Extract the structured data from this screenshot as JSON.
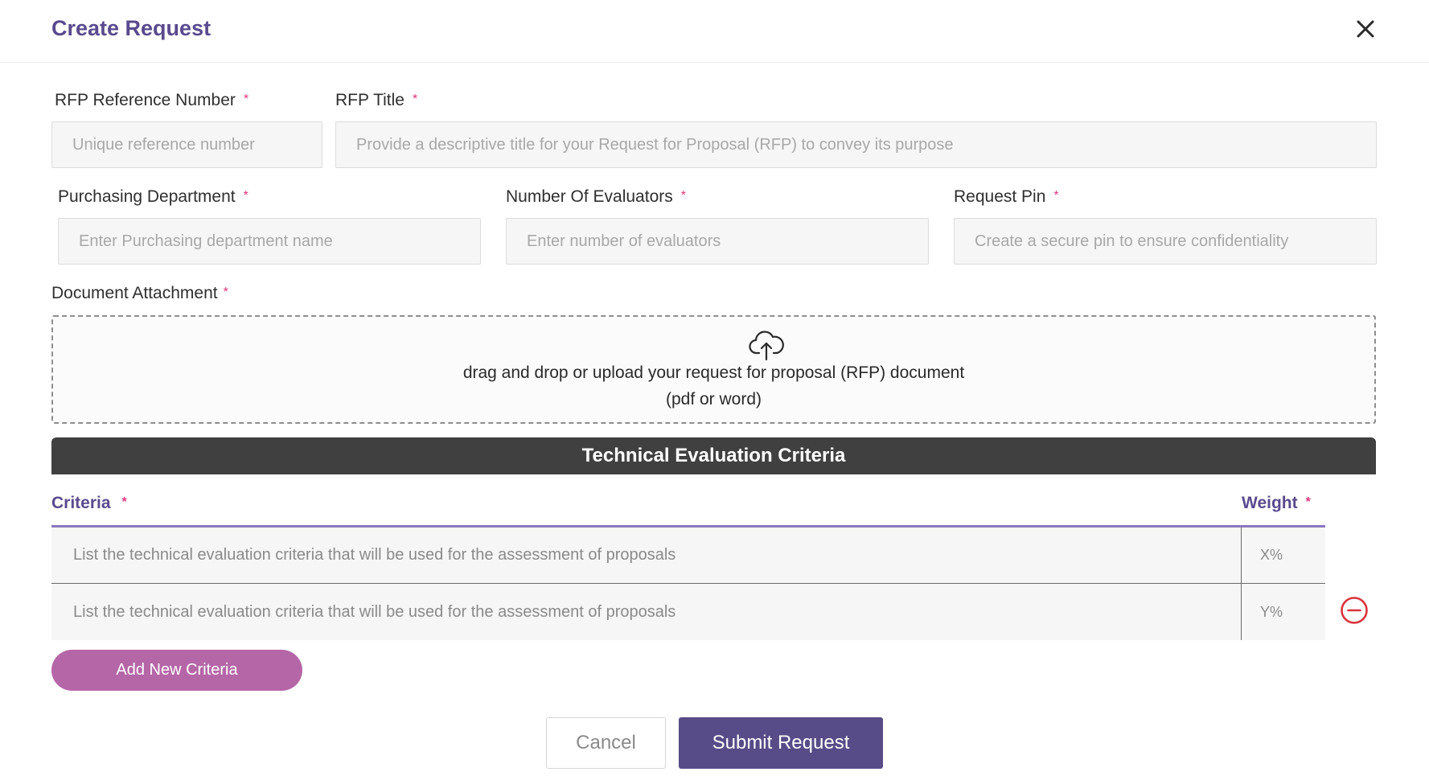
{
  "modal": {
    "title": "Create Request",
    "close_icon": "close-icon"
  },
  "required_marker": "*",
  "fields": {
    "rfp_reference": {
      "label": "RFP Reference Number",
      "value": "",
      "placeholder": "Unique reference number"
    },
    "rfp_title": {
      "label": "RFP Title",
      "value": "",
      "placeholder": "Provide a descriptive title for your Request for Proposal (RFP) to convey its purpose"
    },
    "purchasing_department": {
      "label": "Purchasing Department",
      "value": "",
      "placeholder": "Enter Purchasing department name"
    },
    "number_of_evaluators": {
      "label": "Number Of Evaluators",
      "value": "",
      "placeholder": "Enter number of evaluators"
    },
    "request_pin": {
      "label": "Request Pin",
      "value": "",
      "placeholder": "Create a secure pin to ensure confidentiality"
    }
  },
  "attachment": {
    "label": "Document Attachment",
    "icon": "cloud-upload-icon",
    "line1": "drag and drop or upload your request for proposal (RFP) document",
    "line2": "(pdf or word)"
  },
  "criteria_section": {
    "title": "Technical Evaluation Criteria",
    "criteria_header": "Criteria",
    "weight_header": "Weight",
    "rows": [
      {
        "criteria_placeholder": "List the technical evaluation criteria that will be used for the assessment of proposals",
        "weight_placeholder": "X%"
      },
      {
        "criteria_placeholder": "List the technical evaluation criteria that will be used for the assessment of proposals",
        "weight_placeholder": "Y%",
        "remove_icon": "minus-circle-icon"
      }
    ],
    "add_button": "Add New Criteria"
  },
  "actions": {
    "cancel": "Cancel",
    "submit": "Submit Request"
  },
  "colors": {
    "brand": "#5a4a8e",
    "submit": "#574c87",
    "add_button": "#b566a7",
    "required": "#e0357b",
    "remove": "#d9343f",
    "section_bar": "#404040"
  }
}
